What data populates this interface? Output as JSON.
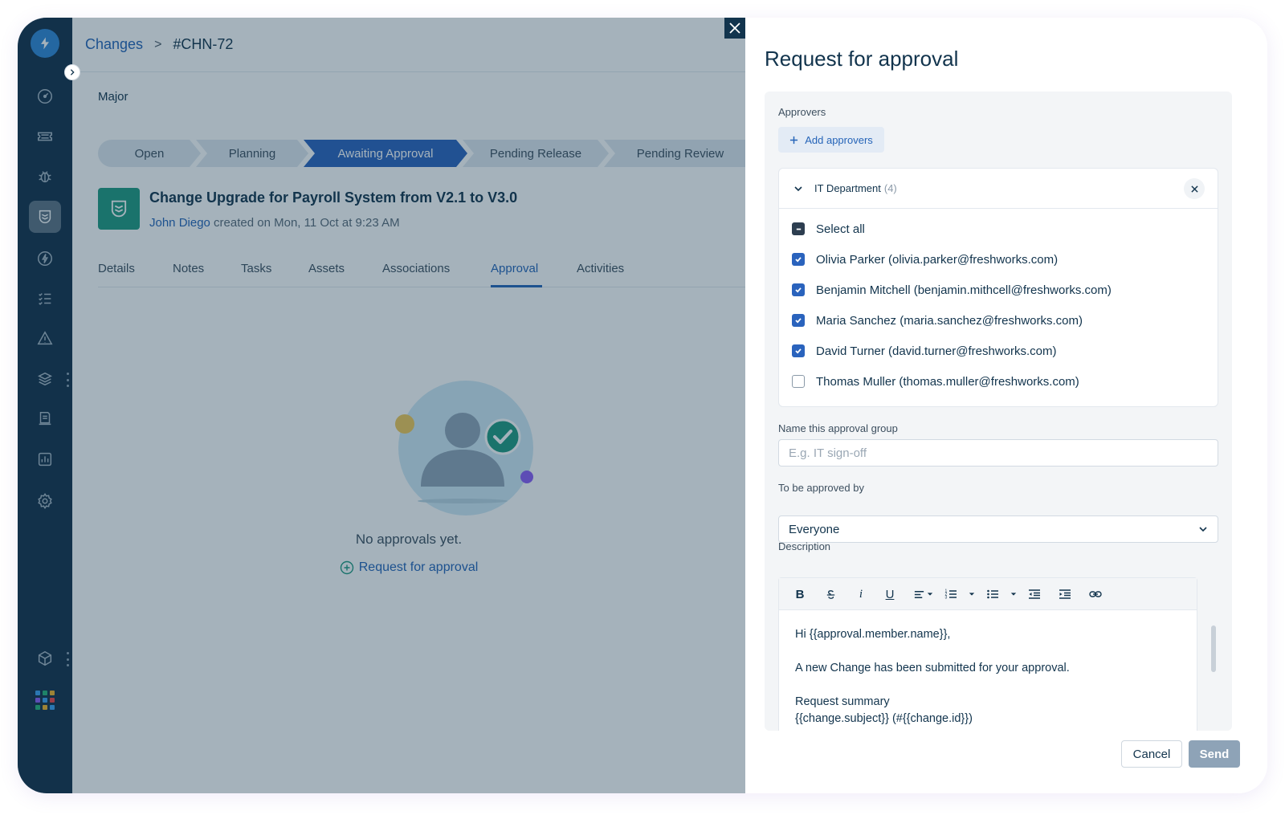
{
  "breadcrumb": {
    "parent": "Changes",
    "separator": ">",
    "current": "#CHN-72"
  },
  "change": {
    "type": "Major",
    "title": "Change Upgrade for Payroll System from V2.1 to V3.0",
    "author": "John Diego",
    "created": " created on Mon, 11 Oct at 9:23 AM"
  },
  "workflow": {
    "stages": [
      "Open",
      "Planning",
      "Awaiting Approval",
      "Pending Release",
      "Pending Review"
    ],
    "active": "Awaiting Approval"
  },
  "tabs": [
    "Details",
    "Notes",
    "Tasks",
    "Assets",
    "Associations",
    "Approval",
    "Activities"
  ],
  "active_tab": "Approval",
  "empty_state": {
    "message": "No approvals yet.",
    "link": "Request for approval"
  },
  "panel": {
    "title": "Request for approval",
    "approvers_label": "Approvers",
    "add_approvers": "Add approvers",
    "group": {
      "name": "IT Department",
      "count": "(4)",
      "select_all": "Select all",
      "members": [
        {
          "label": "Olivia Parker (olivia.parker@freshworks.com)",
          "checked": true
        },
        {
          "label": "Benjamin Mitchell (benjamin.mithcell@freshworks.com)",
          "checked": true
        },
        {
          "label": "Maria Sanchez (maria.sanchez@freshworks.com)",
          "checked": true
        },
        {
          "label": "David Turner (david.turner@freshworks.com)",
          "checked": true
        },
        {
          "label": "Thomas Muller (thomas.muller@freshworks.com)",
          "checked": false
        }
      ]
    },
    "group_name_label": "Name this approval group",
    "group_name_placeholder": "E.g. IT sign-off",
    "approved_by_label": "To be approved by",
    "approved_by_value": "Everyone",
    "description_label": "Description",
    "description_lines": [
      "Hi {{approval.member.name}},",
      "",
      "A new Change has been submitted for your approval.",
      "",
      "Request summary",
      "{{change.subject}} (#{{change.id}})"
    ],
    "cancel": "Cancel",
    "send": "Send"
  },
  "colors": {
    "sidebar": "#13304a",
    "accent": "#2a63bd",
    "brand_green": "#1f9a80"
  }
}
